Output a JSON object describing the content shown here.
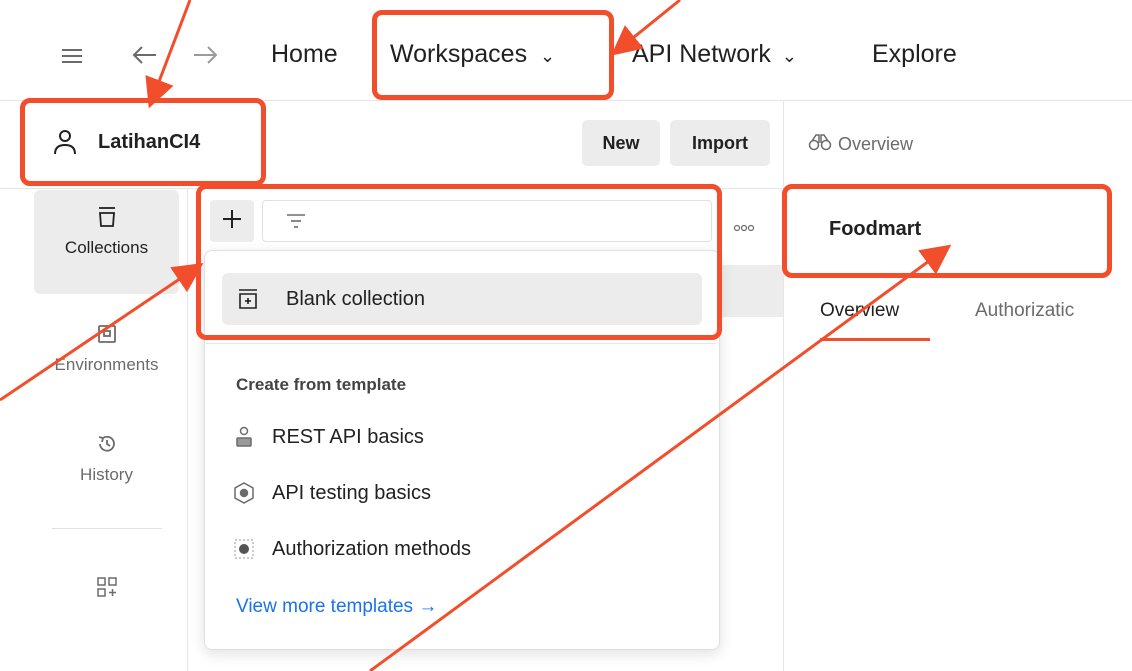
{
  "topnav": {
    "home": "Home",
    "workspaces": "Workspaces",
    "api_network": "API Network",
    "explore": "Explore"
  },
  "workspace": {
    "name": "LatihanCI4",
    "new_label": "New",
    "import_label": "Import"
  },
  "sidebar": {
    "items": [
      {
        "label": "Collections",
        "icon": "collections-icon"
      },
      {
        "label": "Environments",
        "icon": "environments-icon"
      },
      {
        "label": "History",
        "icon": "history-icon"
      }
    ]
  },
  "dropdown": {
    "blank_collection": "Blank collection",
    "section_header": "Create from template",
    "templates": [
      {
        "label": "REST API basics",
        "icon": "user-api-icon"
      },
      {
        "label": "API testing basics",
        "icon": "hexagon-gear-icon"
      },
      {
        "label": "Authorization methods",
        "icon": "square-dot-icon"
      }
    ],
    "view_more": "View more templates →"
  },
  "right_panel": {
    "tab_label": "Overview",
    "collection_name": "Foodmart",
    "tabs": [
      "Overview",
      "Authorizatic"
    ]
  },
  "colors": {
    "accent": "#f24e2b",
    "link": "#1a73e8",
    "selected_bg": "#ececec"
  }
}
